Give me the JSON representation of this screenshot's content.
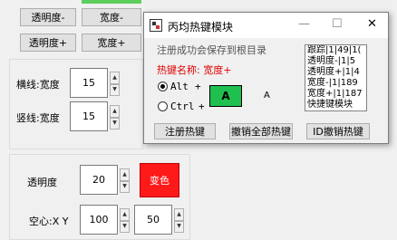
{
  "main": {
    "top_buttons": [
      {
        "label": "透明度-"
      },
      {
        "label": "宽度-"
      },
      {
        "label": "透明度+"
      },
      {
        "label": "宽度+"
      }
    ],
    "line_group": {
      "horizontal_label": "横线:宽度",
      "horizontal_value": "15",
      "vertical_label": "竖线:宽度",
      "vertical_value": "15"
    },
    "style_group": {
      "opacity_label": "透明度",
      "opacity_value": "20",
      "color_button": "变色",
      "hollow_label": "空心:X Y",
      "hollow_x": "100",
      "hollow_y": "50"
    },
    "colors": {
      "color_button_bg": "#ff1a1a",
      "top_strip": "#5ccf5c"
    }
  },
  "dialog": {
    "title": "丙均热键模块",
    "controls": {
      "minimize": "—",
      "maximize": "☐",
      "close": "✕"
    },
    "note": "注册成功会保存到根目录",
    "hotkey_name_label": "热键名称: 宽度+",
    "modifiers": [
      {
        "label": "Alt",
        "plus": "+",
        "selected": true
      },
      {
        "label": "Ctrl",
        "plus": "+",
        "selected": false
      }
    ],
    "key_value": "A",
    "key_echo": "A",
    "list": [
      "跟踪|1|49|1(",
      "透明度-|1|5",
      "透明度+|1|4",
      "宽度-|1|189",
      "宽度+|1|187",
      "快捷键模块"
    ],
    "buttons": {
      "register": "注册热键",
      "unregister_all": "撤销全部热键",
      "unregister_id": "ID撤销热键"
    },
    "colors": {
      "key_box": "#20c050",
      "hotkey_name": "#e00000"
    }
  }
}
